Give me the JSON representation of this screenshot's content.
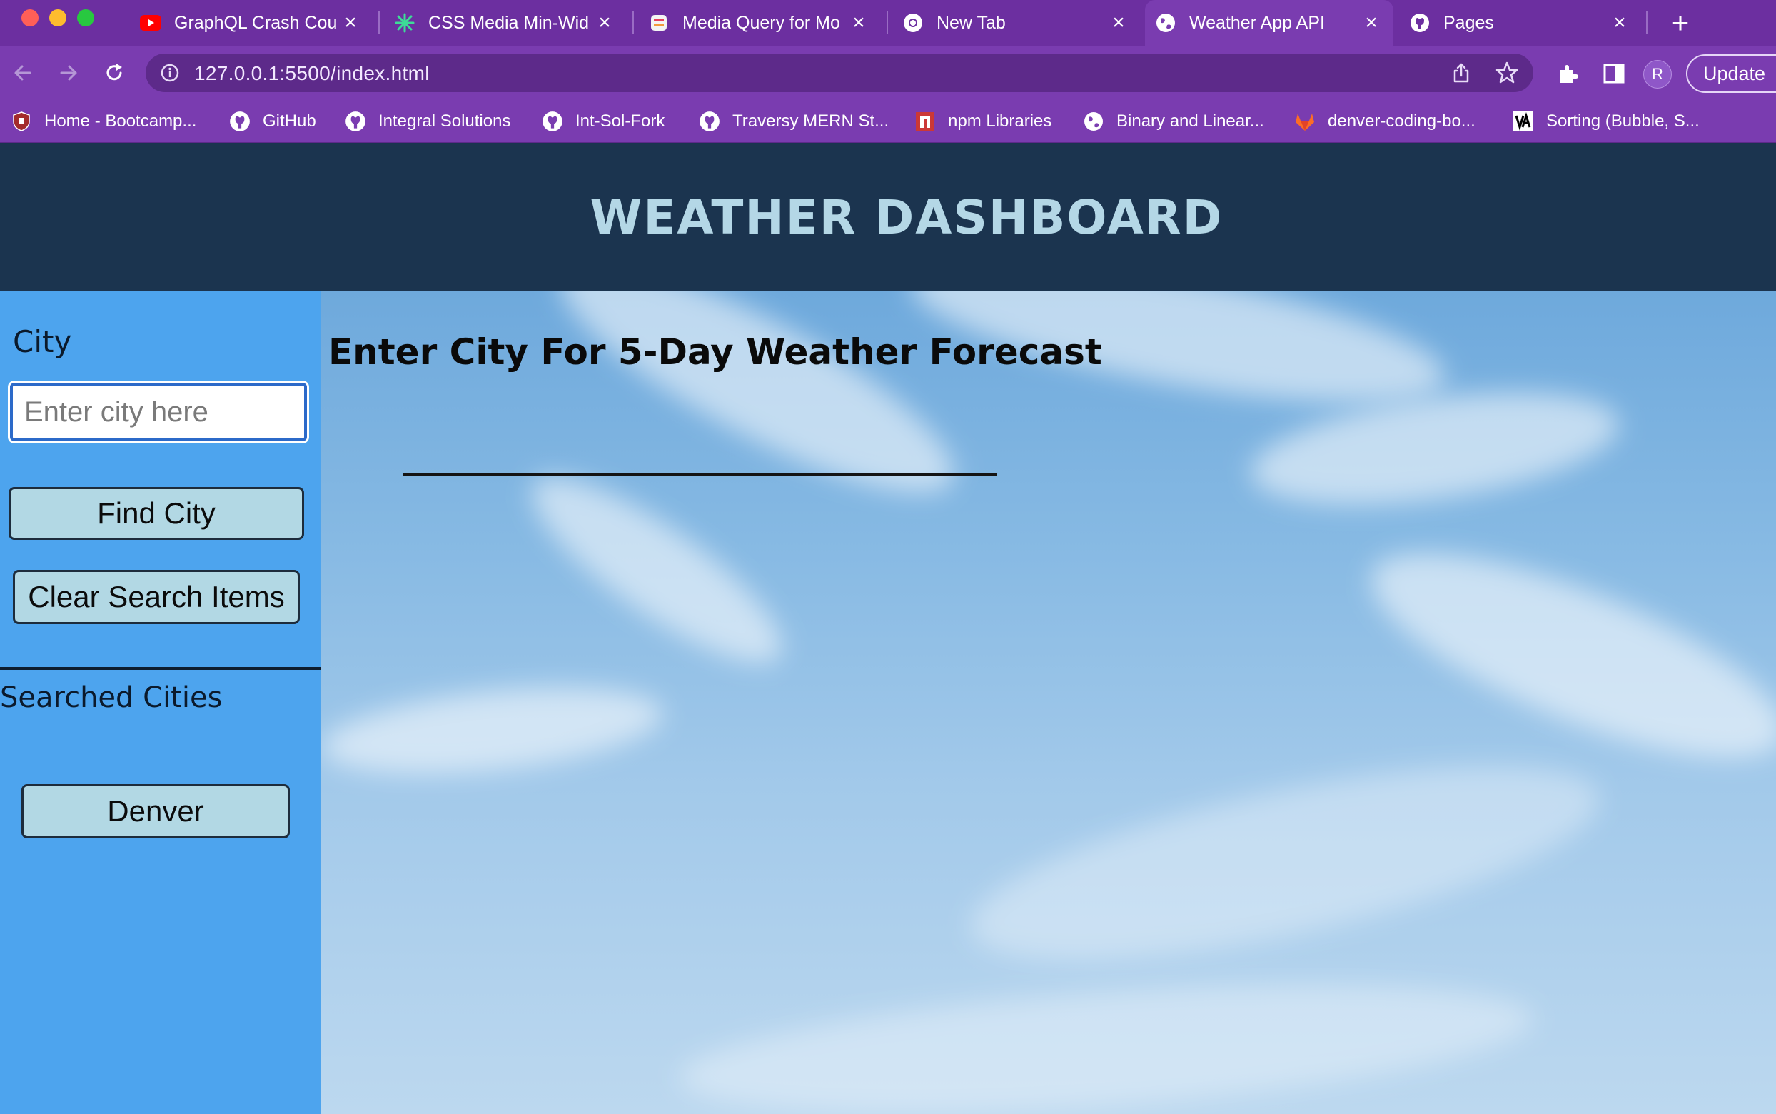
{
  "browser": {
    "tabs": [
      {
        "title": "GraphQL Crash Cou",
        "icon": "youtube-icon"
      },
      {
        "title": "CSS Media Min-Wid",
        "icon": "sparkle-icon"
      },
      {
        "title": "Media Query for Mo",
        "icon": "stack-icon"
      },
      {
        "title": "New Tab",
        "icon": "chrome-icon"
      },
      {
        "title": "Weather App API",
        "icon": "globe-icon",
        "active": true
      },
      {
        "title": "Pages",
        "icon": "github-icon"
      }
    ],
    "url": "127.0.0.1:5500/index.html",
    "avatar_initial": "R",
    "update_label": "Update",
    "bookmarks": [
      {
        "label": "Home - Bootcamp...",
        "icon": "shield-icon"
      },
      {
        "label": "GitHub",
        "icon": "github-icon"
      },
      {
        "label": "Integral Solutions",
        "icon": "github-icon"
      },
      {
        "label": "Int-Sol-Fork",
        "icon": "github-icon"
      },
      {
        "label": "Traversy MERN St...",
        "icon": "github-icon"
      },
      {
        "label": "npm Libraries",
        "icon": "npm-icon"
      },
      {
        "label": "Binary and Linear...",
        "icon": "globe-icon"
      },
      {
        "label": "denver-coding-bo...",
        "icon": "gitlab-icon"
      },
      {
        "label": "Sorting (Bubble, S...",
        "icon": "va-icon"
      }
    ],
    "colors": {
      "frame": "#7a3cb0",
      "tabstrip": "#6c2fa0"
    }
  },
  "page": {
    "title": "WEATHER DASHBOARD",
    "sidebar": {
      "city_label": "City",
      "city_input": {
        "value": "",
        "placeholder": "Enter city here"
      },
      "find_button": "Find City",
      "clear_button": "Clear Search Items",
      "searched_label": "Searched Cities",
      "history": [
        "Denver"
      ]
    },
    "main": {
      "heading": "Enter City For 5-Day Weather Forecast"
    },
    "colors": {
      "header_bg": "#1b344f",
      "header_text": "#b4d7e6",
      "sidebar_bg": "#4da4ee",
      "button_bg": "#b2d8e4"
    }
  }
}
